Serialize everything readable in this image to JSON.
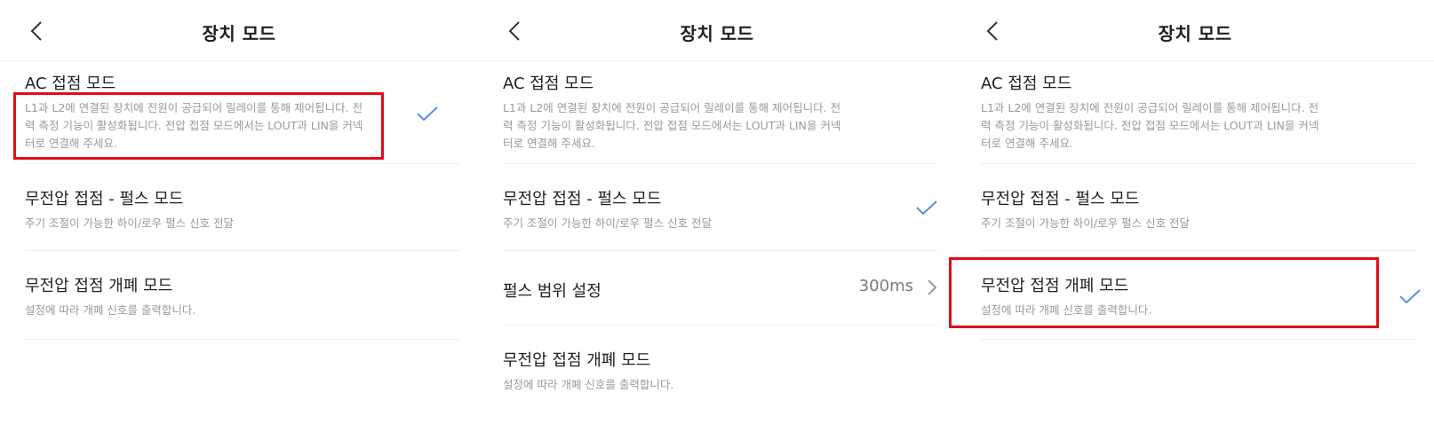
{
  "colors": {
    "accent": "#5b8de5",
    "highlight": "#e10d17",
    "text": "#1f1f1f",
    "subtext": "#9a9a9a"
  },
  "panels": [
    {
      "header": {
        "back_icon": "chevron-left-icon",
        "title": "장치 모드"
      },
      "items": [
        {
          "title": "AC 접점 모드",
          "desc": "L1과 L2에 연결된 장치에 전원이 공급되어 릴레이를 통해 제어됩니다. 전력 측정 기능이 활성화됩니다. 전압 접점 모드에서는 LOUT과 LIN을 커넥터로 연결해 주세요.",
          "selected": true,
          "highlighted": true
        },
        {
          "title": "무전압 접점 - 펄스 모드",
          "desc": "주기 조절이 가능한 하이/로우 펄스 신호 전달",
          "selected": false
        },
        {
          "title": "무전압 접점 개폐 모드",
          "desc": "설정에 따라 개폐 신호를 출력합니다.",
          "selected": false
        }
      ]
    },
    {
      "header": {
        "back_icon": "chevron-left-icon",
        "title": "장치 모드"
      },
      "items": [
        {
          "title": "AC 접점 모드",
          "desc": "L1과 L2에 연결된 장치에 전원이 공급되어 릴레이를 통해 제어됩니다. 전력 측정 기능이 활성화됩니다. 전압 접점 모드에서는 LOUT과 LIN을 커넥터로 연결해 주세요.",
          "selected": false
        },
        {
          "title": "무전압 접점 - 펄스 모드",
          "desc": "주기 조절이 가능한 하이/로우 펄스 신호 전달",
          "selected": true
        },
        {
          "title": "펄스 범위 설정",
          "value": "300ms",
          "chevron_icon": "chevron-right-icon"
        },
        {
          "title": "무전압 접점 개폐 모드",
          "desc": "설정에 따라 개폐 신호를 출력합니다.",
          "selected": false
        }
      ]
    },
    {
      "header": {
        "back_icon": "chevron-left-icon",
        "title": "장치 모드"
      },
      "items": [
        {
          "title": "AC 접점 모드",
          "desc": "L1과 L2에 연결된 장치에 전원이 공급되어 릴레이를 통해 제어됩니다. 전력 측정 기능이 활성화됩니다. 전압 접점 모드에서는 LOUT과 LIN을 커넥터로 연결해 주세요.",
          "selected": false
        },
        {
          "title": "무전압 접점 - 펄스 모드",
          "desc": "주기 조절이 가능한 하이/로우 펄스 신호 전달",
          "selected": false
        },
        {
          "title": "무전압 접점 개폐 모드",
          "desc": "설정에 따라 개폐 신호를 출력합니다.",
          "selected": true,
          "highlighted": true
        }
      ]
    }
  ]
}
